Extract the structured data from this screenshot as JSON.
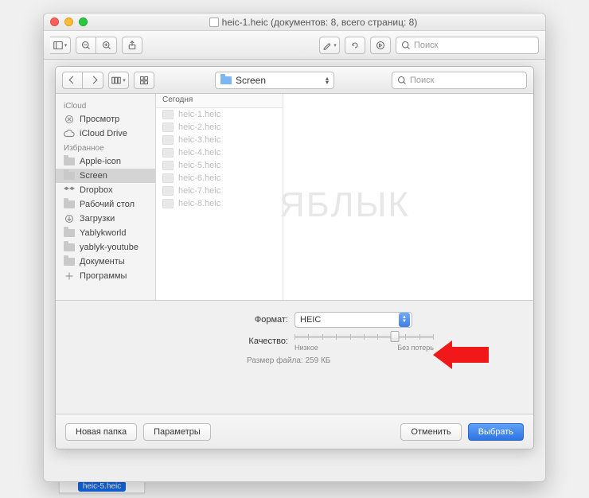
{
  "window": {
    "title": "heic-1.heic (документов: 8, всего страниц: 8)"
  },
  "main_toolbar": {
    "search_placeholder": "Поиск"
  },
  "sheet_toolbar": {
    "folder": "Screen",
    "search_placeholder": "Поиск"
  },
  "sidebar": {
    "groups": [
      {
        "header": "iCloud",
        "items": [
          {
            "label": "Просмотр",
            "icon": "appstore"
          },
          {
            "label": "iCloud Drive",
            "icon": "cloud"
          }
        ]
      },
      {
        "header": "Избранное",
        "items": [
          {
            "label": "Apple-icon",
            "icon": "folder"
          },
          {
            "label": "Screen",
            "icon": "folder",
            "selected": true
          },
          {
            "label": "Dropbox",
            "icon": "dropbox"
          },
          {
            "label": "Рабочий стол",
            "icon": "desktop"
          },
          {
            "label": "Загрузки",
            "icon": "download"
          },
          {
            "label": "Yablykworld",
            "icon": "folder"
          },
          {
            "label": "yablyk-youtube",
            "icon": "folder"
          },
          {
            "label": "Документы",
            "icon": "folder"
          },
          {
            "label": "Программы",
            "icon": "apps"
          }
        ]
      }
    ]
  },
  "column": {
    "header": "Сегодня",
    "files": [
      "heic-1.heic",
      "heic-2.heic",
      "heic-3.heic",
      "heic-4.heic",
      "heic-5.heic",
      "heic-6.heic",
      "heic-7.heic",
      "heic-8.heic"
    ]
  },
  "watermark": "ЯБЛЫК",
  "options": {
    "format_label": "Формат:",
    "format_value": "HEIC",
    "quality_label": "Качество:",
    "quality_low": "Низкое",
    "quality_lossless": "Без потерь",
    "filesize_label": "Размер файла:",
    "filesize_value": "259 КБ"
  },
  "footer": {
    "new_folder": "Новая папка",
    "parameters": "Параметры",
    "cancel": "Отменить",
    "choose": "Выбрать"
  },
  "thumbnail": {
    "caption": "heic-5.heic"
  }
}
